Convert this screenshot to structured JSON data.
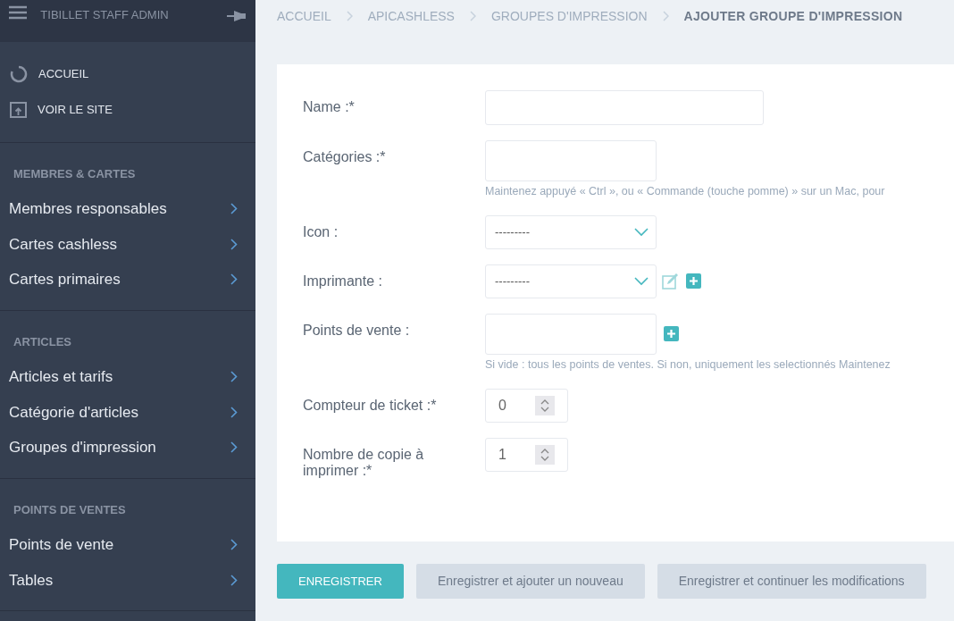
{
  "sidebar": {
    "title": "TIBILLET STAFF ADMIN",
    "links": [
      {
        "kind": "home",
        "label": "ACCUEIL"
      },
      {
        "kind": "site",
        "label": "VOIR LE SITE"
      }
    ],
    "sections": [
      {
        "title": "MEMBRES & CARTES",
        "items": [
          "Membres responsables",
          "Cartes cashless",
          "Cartes primaires"
        ]
      },
      {
        "title": "ARTICLES",
        "items": [
          "Articles et tarifs",
          "Catégorie d'articles",
          "Groupes d'impression"
        ]
      },
      {
        "title": "POINTS DE VENTES",
        "items": [
          "Points de vente",
          "Tables"
        ]
      }
    ]
  },
  "breadcrumb": [
    {
      "label": "ACCUEIL",
      "selected": false
    },
    {
      "label": "APICASHLESS",
      "selected": false
    },
    {
      "label": "GROUPES D'IMPRESSION",
      "selected": false
    },
    {
      "label": "AJOUTER GROUPE D'IMPRESSION",
      "selected": true
    }
  ],
  "form": {
    "fields": [
      {
        "kind": "text",
        "label": "Name :*"
      },
      {
        "kind": "multi",
        "label": "Catégories :*",
        "help": "Maintenez appuyé « Ctrl », ou « Commande (touche pomme) » sur un Mac, pour"
      },
      {
        "kind": "select",
        "label": "Icon :",
        "value": "---------"
      },
      {
        "kind": "select_edit",
        "label": "Imprimante :",
        "value": "---------"
      },
      {
        "kind": "multi_add",
        "label": "Points de vente :",
        "help": "Si vide : tous les points de ventes. Si non, uniquement les selectionnés Maintenez"
      },
      {
        "kind": "number",
        "label": "Compteur de ticket :*",
        "value": "0"
      },
      {
        "kind": "number",
        "label": "Nombre de copie à imprimer :*",
        "value": "1"
      }
    ]
  },
  "buttons": [
    {
      "kind": "primary",
      "label": "ENREGISTRER"
    },
    {
      "kind": "secondary",
      "label": "Enregistrer et ajouter un nouveau"
    },
    {
      "kind": "secondary",
      "label": "Enregistrer et continuer les modifications"
    }
  ]
}
